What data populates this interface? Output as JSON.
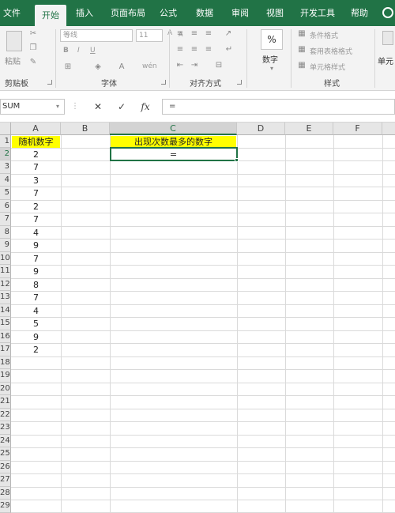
{
  "tabs": [
    "文件",
    "开始",
    "插入",
    "页面布局",
    "公式",
    "数据",
    "审阅",
    "视图",
    "开发工具",
    "帮助"
  ],
  "ribbon": {
    "clipboard": {
      "paste_label": "粘贴",
      "group_label": "剪贴板"
    },
    "font": {
      "font_name": "等线",
      "font_size": "11",
      "bold": "B",
      "italic": "I",
      "underline": "U",
      "grow": "A",
      "shrink": "A",
      "phonetic": "wén",
      "group_label": "字体"
    },
    "alignment": {
      "group_label": "对齐方式"
    },
    "number": {
      "percent": "%",
      "label": "数字"
    },
    "styles": {
      "conditional": "条件格式",
      "table": "套用表格格式",
      "cell_styles": "单元格样式",
      "group_label": "样式"
    },
    "cells": {
      "label": "单元"
    }
  },
  "formula_bar": {
    "name_box": "SUM",
    "cancel": "✕",
    "enter": "✓",
    "fx": "fx",
    "content": "="
  },
  "columns": [
    "A",
    "B",
    "C",
    "D",
    "E",
    "F"
  ],
  "rows": [
    "1",
    "2",
    "3",
    "4",
    "5",
    "6",
    "7",
    "8",
    "9",
    "10",
    "11",
    "12",
    "13",
    "14",
    "15",
    "16",
    "17",
    "18",
    "19",
    "20",
    "21",
    "22",
    "23",
    "24",
    "25",
    "26",
    "27",
    "28",
    "29"
  ],
  "cells": {
    "A1": "随机数字",
    "C1": "出现次数最多的数字",
    "C2": "=",
    "column_A": [
      "2",
      "7",
      "3",
      "7",
      "2",
      "7",
      "4",
      "9",
      "7",
      "9",
      "8",
      "7",
      "4",
      "5",
      "9",
      "2"
    ]
  },
  "active_cell": "C2",
  "colors": {
    "accent": "#217346",
    "highlight": "#ffff00"
  }
}
